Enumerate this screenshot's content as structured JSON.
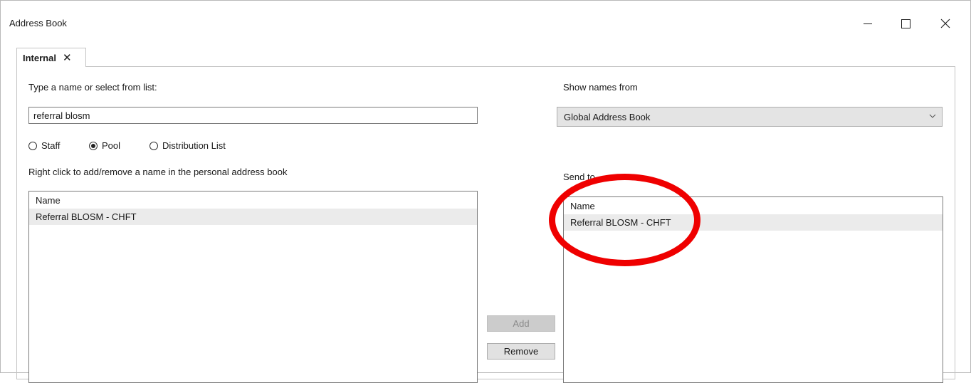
{
  "window": {
    "title": "Address Book"
  },
  "tab": {
    "label": "Internal",
    "close_glyph": "✕"
  },
  "search": {
    "label": "Type a name or select from list:",
    "value": "referral blosm"
  },
  "filter": {
    "options": [
      {
        "label": "Staff",
        "selected": false
      },
      {
        "label": "Pool",
        "selected": true
      },
      {
        "label": "Distribution List",
        "selected": false
      }
    ]
  },
  "hint": "Right click to add/remove a name in the personal address book",
  "results": {
    "header": "Name",
    "rows": [
      "Referral BLOSM - CHFT"
    ]
  },
  "source": {
    "label": "Show names from",
    "selected": "Global Address Book"
  },
  "send_to": {
    "label": "Send to",
    "header": "Name",
    "rows": [
      "Referral BLOSM - CHFT"
    ]
  },
  "buttons": {
    "add": "Add",
    "remove": "Remove"
  },
  "colors": {
    "highlight": "#ef0000",
    "selected_row": "#ebebeb",
    "disabled_button": "#cccccc"
  },
  "icons": [
    "minimize-icon",
    "maximize-icon",
    "close-icon",
    "radio-button-icon",
    "chevron-down-icon"
  ]
}
